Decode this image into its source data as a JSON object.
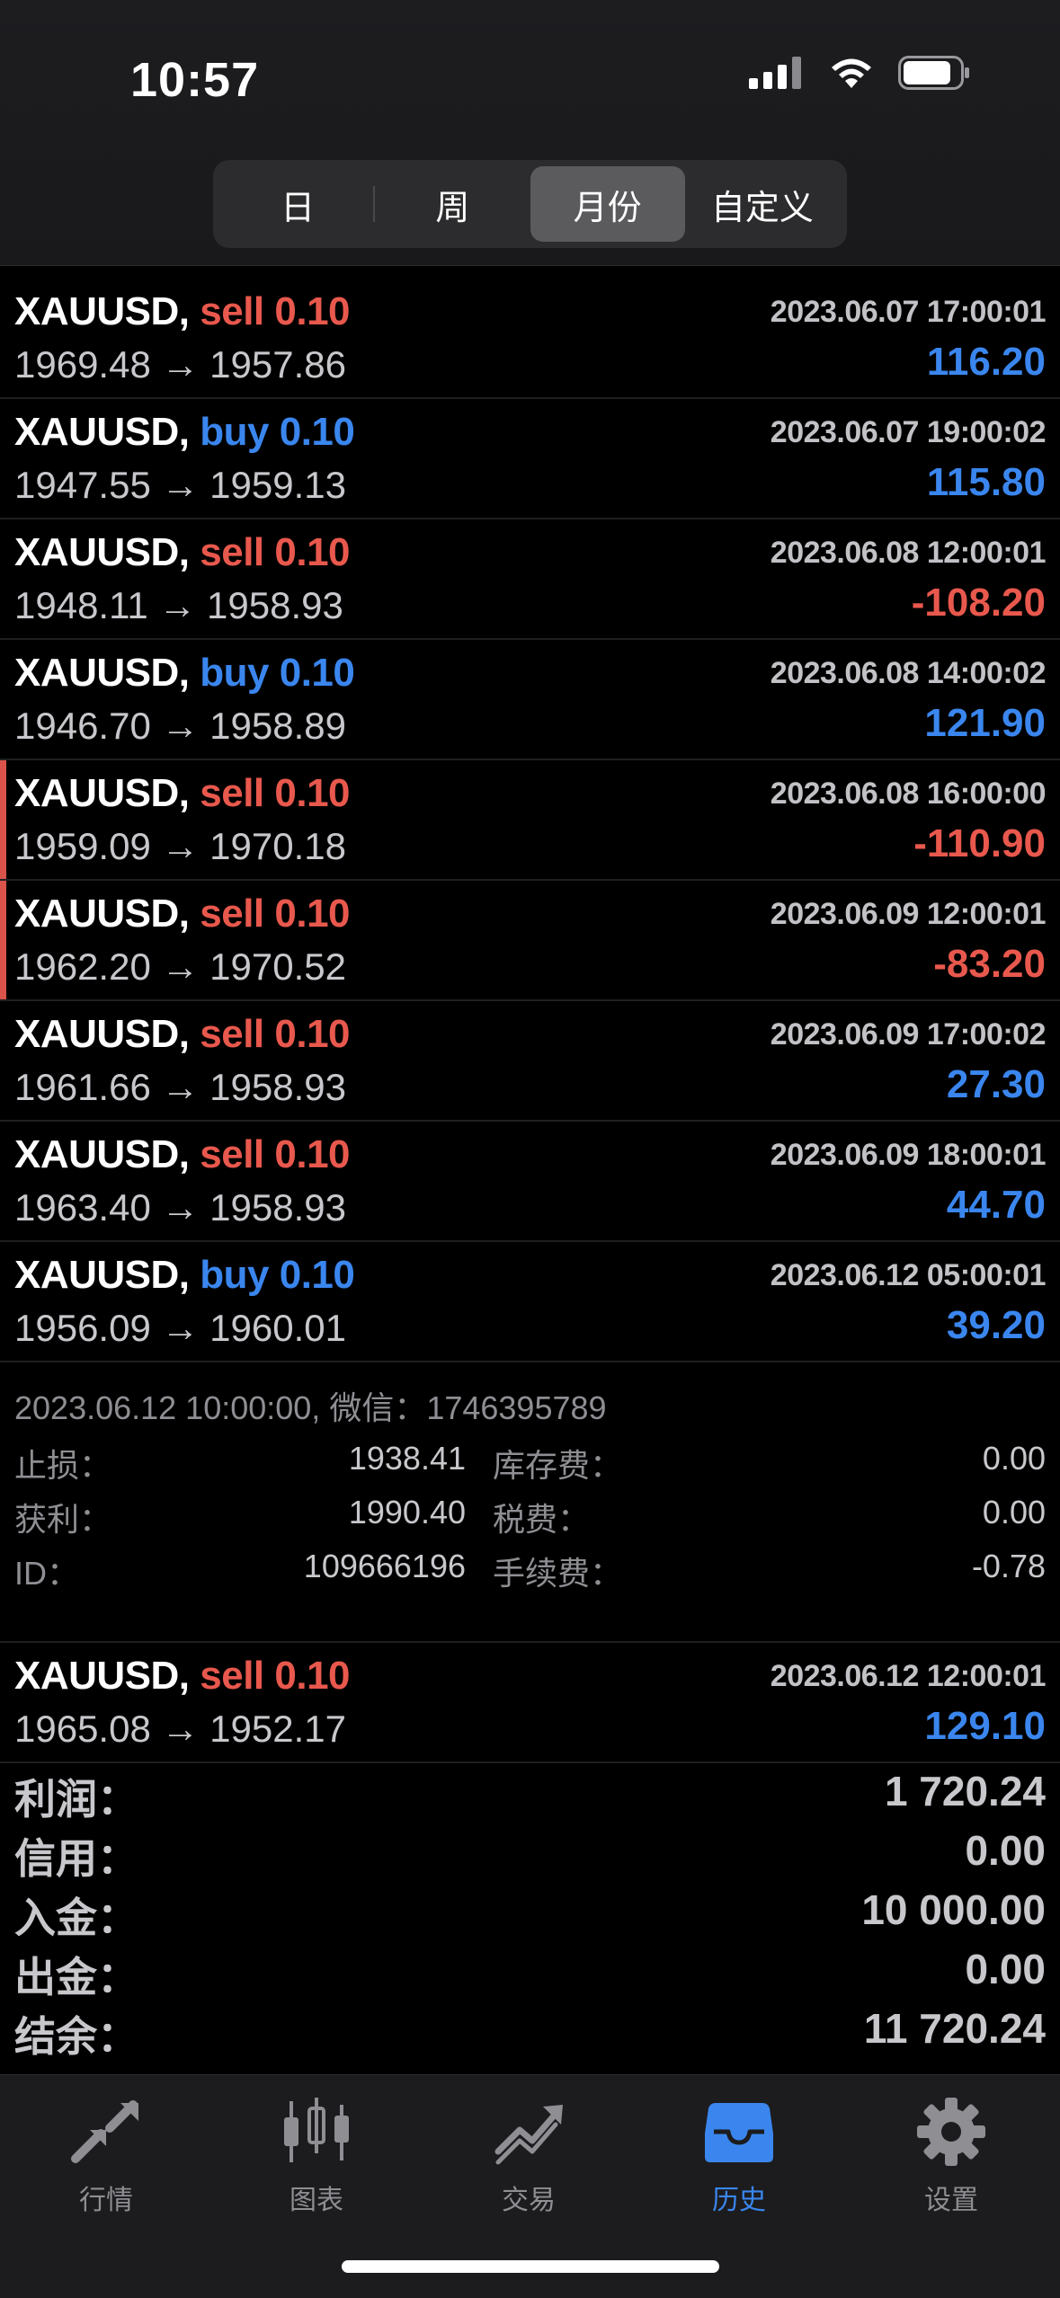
{
  "status": {
    "time": "10:57"
  },
  "segments": [
    {
      "label": "日",
      "active": false
    },
    {
      "label": "周",
      "active": false
    },
    {
      "label": "月份",
      "active": true
    },
    {
      "label": "自定义",
      "active": false
    }
  ],
  "trades": [
    {
      "symbol": "XAUUSD,",
      "side": "sell",
      "volume": "0.10",
      "datetime": "2023.06.07 17:00:01",
      "open": "1969.48",
      "close": "1957.86",
      "profit": "116.20",
      "profit_sign": "pos",
      "marked": false
    },
    {
      "symbol": "XAUUSD,",
      "side": "buy",
      "volume": "0.10",
      "datetime": "2023.06.07 19:00:02",
      "open": "1947.55",
      "close": "1959.13",
      "profit": "115.80",
      "profit_sign": "pos",
      "marked": false
    },
    {
      "symbol": "XAUUSD,",
      "side": "sell",
      "volume": "0.10",
      "datetime": "2023.06.08 12:00:01",
      "open": "1948.11",
      "close": "1958.93",
      "profit": "-108.20",
      "profit_sign": "neg",
      "marked": false
    },
    {
      "symbol": "XAUUSD,",
      "side": "buy",
      "volume": "0.10",
      "datetime": "2023.06.08 14:00:02",
      "open": "1946.70",
      "close": "1958.89",
      "profit": "121.90",
      "profit_sign": "pos",
      "marked": false
    },
    {
      "symbol": "XAUUSD,",
      "side": "sell",
      "volume": "0.10",
      "datetime": "2023.06.08 16:00:00",
      "open": "1959.09",
      "close": "1970.18",
      "profit": "-110.90",
      "profit_sign": "neg",
      "marked": true
    },
    {
      "symbol": "XAUUSD,",
      "side": "sell",
      "volume": "0.10",
      "datetime": "2023.06.09 12:00:01",
      "open": "1962.20",
      "close": "1970.52",
      "profit": "-83.20",
      "profit_sign": "neg",
      "marked": true
    },
    {
      "symbol": "XAUUSD,",
      "side": "sell",
      "volume": "0.10",
      "datetime": "2023.06.09 17:00:02",
      "open": "1961.66",
      "close": "1958.93",
      "profit": "27.30",
      "profit_sign": "pos",
      "marked": false
    },
    {
      "symbol": "XAUUSD,",
      "side": "sell",
      "volume": "0.10",
      "datetime": "2023.06.09 18:00:01",
      "open": "1963.40",
      "close": "1958.93",
      "profit": "44.70",
      "profit_sign": "pos",
      "marked": false
    },
    {
      "symbol": "XAUUSD,",
      "side": "buy",
      "volume": "0.10",
      "datetime": "2023.06.12 05:00:01",
      "open": "1956.09",
      "close": "1960.01",
      "profit": "39.20",
      "profit_sign": "pos",
      "marked": false
    }
  ],
  "arrow": "→",
  "detail": {
    "header": "2023.06.12 10:00:00, 微信：1746395789",
    "sl_label": "止损：",
    "sl_value": "1938.41",
    "tp_label": "获利：",
    "tp_value": "1990.40",
    "id_label": "ID：",
    "id_value": "109666196",
    "swap_label": "库存费：",
    "swap_value": "0.00",
    "tax_label": "税费：",
    "tax_value": "0.00",
    "fee_label": "手续费：",
    "fee_value": "-0.78"
  },
  "last_trade": {
    "symbol": "XAUUSD,",
    "side": "sell",
    "volume": "0.10",
    "datetime": "2023.06.12 12:00:01",
    "open": "1965.08",
    "close": "1952.17",
    "profit": "129.10",
    "profit_sign": "pos"
  },
  "summary": [
    {
      "label": "利润：",
      "value": "1 720.24"
    },
    {
      "label": "信用：",
      "value": "0.00"
    },
    {
      "label": "入金：",
      "value": "10 000.00"
    },
    {
      "label": "出金：",
      "value": "0.00"
    },
    {
      "label": "结余：",
      "value": "11 720.24"
    }
  ],
  "tabs": [
    {
      "label": "行情",
      "icon": "quotes-arrows-icon",
      "active": false
    },
    {
      "label": "图表",
      "icon": "candlestick-chart-icon",
      "active": false
    },
    {
      "label": "交易",
      "icon": "trade-trend-icon",
      "active": false
    },
    {
      "label": "历史",
      "icon": "history-tray-icon",
      "active": true
    },
    {
      "label": "设置",
      "icon": "gear-icon",
      "active": false
    }
  ],
  "colors": {
    "sell": "#e8584d",
    "buy": "#3a86ee",
    "active_tab": "#3a86ee",
    "inactive_tab": "#8e8e93"
  }
}
